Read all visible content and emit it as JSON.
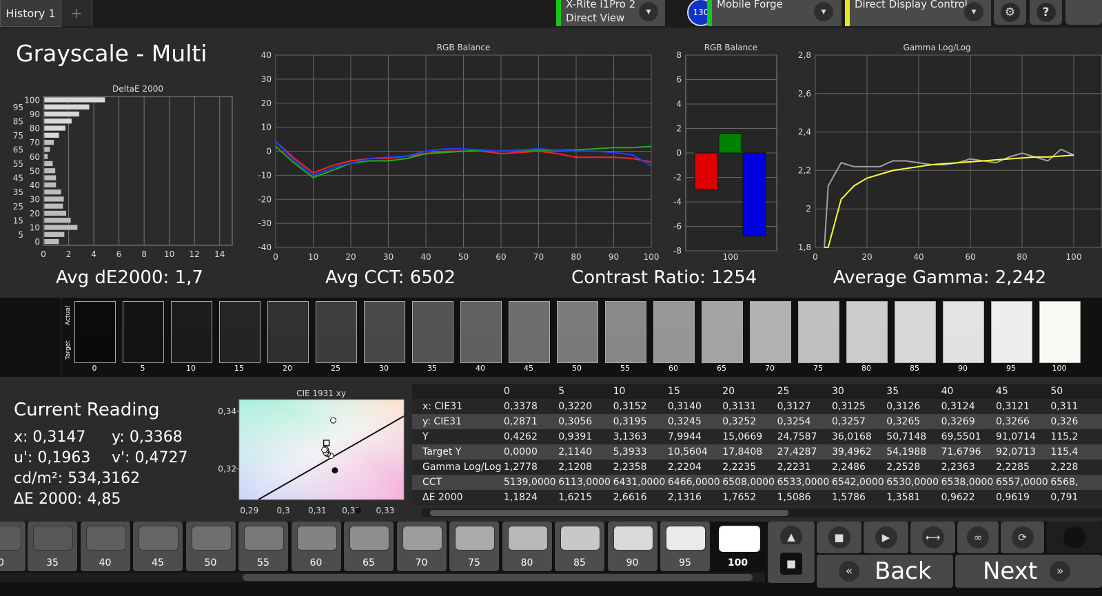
{
  "tabs": {
    "active": "History 1",
    "add": "+"
  },
  "devices": {
    "meter": {
      "line1": "X-Rite i1Pro 2",
      "line2": "Direct View",
      "color": "#18c818"
    },
    "badge": "130",
    "pattern_gen": {
      "label": "Mobile Forge",
      "color": "#18c818"
    },
    "display": {
      "label": "Direct Display Control",
      "color": "#e8e820"
    }
  },
  "icons": {
    "dropdown": "▾",
    "settings": "⚙",
    "help": "?"
  },
  "title": "Grayscale - Multi",
  "summary": {
    "avg_de": "Avg dE2000: 1,7",
    "avg_cct": "Avg CCT: 6502",
    "contrast": "Contrast Ratio: 1254",
    "gamma": "Average Gamma: 2,242"
  },
  "chart_data": [
    {
      "type": "bar",
      "title": "DeltaE 2000",
      "orientation": "horizontal",
      "categories": [
        "100",
        "95",
        "90",
        "85",
        "80",
        "75",
        "70",
        "65",
        "60",
        "55",
        "50",
        "45",
        "40",
        "35",
        "30",
        "25",
        "20",
        "15",
        "10",
        "5",
        "0"
      ],
      "values": [
        4.85,
        3.6,
        2.8,
        2.2,
        1.7,
        1.2,
        0.79,
        0.48,
        0.3,
        0.7,
        0.9,
        0.96,
        0.96,
        1.36,
        1.58,
        1.51,
        1.77,
        2.13,
        2.66,
        1.62,
        1.18
      ],
      "xticks": [
        "0",
        "2",
        "4",
        "6",
        "8",
        "10",
        "12",
        "14"
      ],
      "yticks": [
        "100",
        "95",
        "90",
        "85",
        "80",
        "75",
        "70",
        "65",
        "60",
        "55",
        "50",
        "45",
        "40",
        "35",
        "30",
        "25",
        "20",
        "15",
        "10",
        "5",
        "0"
      ],
      "xlim": [
        0,
        15
      ]
    },
    {
      "type": "line",
      "title": "RGB Balance",
      "x": [
        0,
        5,
        10,
        15,
        20,
        25,
        30,
        35,
        40,
        45,
        50,
        55,
        60,
        65,
        70,
        75,
        80,
        85,
        90,
        95,
        100
      ],
      "series": [
        {
          "color": "#ff2020",
          "values": [
            4,
            -3,
            -9,
            -6,
            -4,
            -3,
            -3,
            -2,
            -1,
            0,
            0,
            0,
            -1,
            -0.5,
            0,
            -1,
            -2.5,
            -2.5,
            -2.5,
            -3,
            -4.5
          ]
        },
        {
          "color": "#20b020",
          "values": [
            2,
            -5,
            -11,
            -8,
            -5,
            -4,
            -4,
            -3,
            -1,
            -0.5,
            0,
            0.5,
            0,
            0.5,
            0.5,
            0.5,
            0.5,
            1,
            1.5,
            1.5,
            2
          ]
        },
        {
          "color": "#2040ff",
          "values": [
            4,
            -4,
            -10,
            -7,
            -5,
            -3,
            -2.5,
            -2,
            0,
            1,
            1,
            0.5,
            0,
            0.5,
            1,
            0.5,
            0,
            0,
            -0.5,
            -1.5,
            -6
          ]
        }
      ],
      "xticks": [
        "0",
        "10",
        "20",
        "30",
        "40",
        "50",
        "60",
        "70",
        "80",
        "90",
        "100"
      ],
      "yticks": [
        "40",
        "30",
        "20",
        "10",
        "0",
        "-10",
        "-20",
        "-30",
        "-40"
      ],
      "ylim": [
        -40,
        40
      ]
    },
    {
      "type": "bar",
      "title": "RGB Balance",
      "categories": [
        "R",
        "G",
        "B"
      ],
      "series": [
        {
          "color": "#e00000",
          "values": [
            -3
          ]
        },
        {
          "color": "#008000",
          "values": [
            1.6
          ]
        },
        {
          "color": "#0000e0",
          "values": [
            -6.8
          ]
        }
      ],
      "xlabel_tick": "100",
      "yticks": [
        "8",
        "6",
        "4",
        "2",
        "0",
        "-2",
        "-4",
        "-6",
        "-8"
      ],
      "ylim": [
        -8,
        8
      ]
    },
    {
      "type": "line",
      "title": "Gamma Log/Log",
      "x": [
        0,
        5,
        10,
        15,
        20,
        25,
        30,
        35,
        40,
        45,
        50,
        55,
        60,
        65,
        70,
        75,
        80,
        85,
        90,
        95,
        100
      ],
      "series": [
        {
          "color": "#a0a0a0",
          "values": [
            1.28,
            2.12,
            2.24,
            2.22,
            2.22,
            2.22,
            2.25,
            2.25,
            2.24,
            2.23,
            2.23,
            2.24,
            2.26,
            2.25,
            2.24,
            2.27,
            2.29,
            2.27,
            2.25,
            2.31,
            2.28
          ]
        },
        {
          "color": "#ffff30",
          "values": [
            1.8,
            1.8,
            2.05,
            2.12,
            2.16,
            2.18,
            2.2,
            2.21,
            2.22,
            2.23,
            2.235,
            2.24,
            2.245,
            2.25,
            2.255,
            2.26,
            2.265,
            2.27,
            2.27,
            2.275,
            2.28
          ]
        }
      ],
      "xticks": [
        "0",
        "20",
        "40",
        "60",
        "80",
        "100"
      ],
      "yticks": [
        "2,8",
        "2,6",
        "2,4",
        "2,2",
        "2",
        "1,8"
      ],
      "ylim": [
        1.8,
        2.8
      ]
    },
    {
      "type": "scatter",
      "title": "CIE 1931 xy",
      "xticks": [
        "0,29",
        "0,3",
        "0,31",
        "0,32",
        "0,33"
      ],
      "yticks": [
        "0,34",
        "0,32"
      ],
      "target": {
        "x": 0.3127,
        "y": 0.329
      },
      "points": [
        {
          "x": 0.3147,
          "y": 0.3368
        },
        {
          "x": 0.314,
          "y": 0.3245
        },
        {
          "x": 0.3131,
          "y": 0.3252
        },
        {
          "x": 0.3127,
          "y": 0.3254
        },
        {
          "x": 0.3125,
          "y": 0.3257
        },
        {
          "x": 0.3126,
          "y": 0.3265
        },
        {
          "x": 0.3124,
          "y": 0.3269
        },
        {
          "x": 0.3121,
          "y": 0.3266
        },
        {
          "x": 0.3152,
          "y": 0.3195
        },
        {
          "x": 0.322,
          "y": 0.3056
        }
      ]
    }
  ],
  "swatches": {
    "actual_label": "Actual",
    "target_label": "Target",
    "labels": [
      "0",
      "5",
      "10",
      "15",
      "20",
      "25",
      "30",
      "35",
      "40",
      "45",
      "50",
      "55",
      "60",
      "65",
      "70",
      "75",
      "80",
      "85",
      "90",
      "95",
      "100"
    ],
    "actual_colors": [
      "#0c0c0c",
      "#141214",
      "#1d1b1d",
      "#262426",
      "#333133",
      "#3f3d3f",
      "#4a484a",
      "#555355",
      "#626062",
      "#6f6d6f",
      "#7c7a7c",
      "#8a888a",
      "#989698",
      "#a5a3a5",
      "#b3b1b3",
      "#c1bfc1",
      "#cdcbcd",
      "#d9d7d9",
      "#e4e2e4",
      "#eeeeee",
      "#fafaf5"
    ],
    "target_colors": [
      "#0a0a0a",
      "#131113",
      "#1b1a1b",
      "#252325",
      "#322f32",
      "#3d3b3d",
      "#494749",
      "#545254",
      "#615f61",
      "#6e6c6e",
      "#7b797b",
      "#898789",
      "#979597",
      "#a4a2a4",
      "#b2b0b2",
      "#c0bec0",
      "#cccacc",
      "#d8d6d8",
      "#e3e1e3",
      "#ededed",
      "#fafaf5"
    ]
  },
  "current_reading": {
    "title": "Current Reading",
    "x": "x: 0,3147",
    "y": "y: 0,3368",
    "u": "u': 0,1963",
    "v": "v': 0,4727",
    "cd": "cd/m²: 534,3162",
    "de": "ΔE 2000: 4,85"
  },
  "table": {
    "columns": [
      "0",
      "5",
      "10",
      "15",
      "20",
      "25",
      "30",
      "35",
      "40",
      "45",
      "50"
    ],
    "rows": [
      {
        "label": "x: CIE31",
        "values": [
          "0,3378",
          "0,3220",
          "0,3152",
          "0,3140",
          "0,3131",
          "0,3127",
          "0,3125",
          "0,3126",
          "0,3124",
          "0,3121",
          "0,311"
        ]
      },
      {
        "label": "y: CIE31",
        "values": [
          "0,2871",
          "0,3056",
          "0,3195",
          "0,3245",
          "0,3252",
          "0,3254",
          "0,3257",
          "0,3265",
          "0,3269",
          "0,3266",
          "0,326"
        ]
      },
      {
        "label": "Y",
        "values": [
          "0,4262",
          "0,9391",
          "3,1363",
          "7,9944",
          "15,0669",
          "24,7587",
          "36,0168",
          "50,7148",
          "69,5501",
          "91,0714",
          "115,2"
        ]
      },
      {
        "label": "Target Y",
        "values": [
          "0,0000",
          "2,1140",
          "5,3933",
          "10,5604",
          "17,8408",
          "27,4287",
          "39,4962",
          "54,1988",
          "71,6796",
          "92,0713",
          "115,4"
        ]
      },
      {
        "label": "Gamma Log/Log",
        "values": [
          "1,2778",
          "2,1208",
          "2,2358",
          "2,2204",
          "2,2235",
          "2,2231",
          "2,2486",
          "2,2528",
          "2,2363",
          "2,2285",
          "2,228"
        ]
      },
      {
        "label": "CCT",
        "values": [
          "5139,0000",
          "6113,0000",
          "6431,0000",
          "6466,0000",
          "6508,0000",
          "6533,0000",
          "6542,0000",
          "6530,0000",
          "6538,0000",
          "6557,0000",
          "6568,"
        ]
      },
      {
        "label": "ΔE 2000",
        "values": [
          "1,1824",
          "1,6215",
          "2,6616",
          "2,1316",
          "1,7652",
          "1,5086",
          "1,5786",
          "1,3581",
          "0,9622",
          "0,9619",
          "0,791"
        ]
      }
    ]
  },
  "footer": {
    "swatch_labels": [
      "0",
      "35",
      "40",
      "45",
      "50",
      "55",
      "60",
      "65",
      "70",
      "75",
      "80",
      "85",
      "90",
      "95",
      "100"
    ],
    "swatch_colors": [
      "#5a5a5a",
      "#575757",
      "#5f5f5f",
      "#666666",
      "#6f6f6f",
      "#787878",
      "#838383",
      "#8f8f8f",
      "#9d9d9d",
      "#aaaaaa",
      "#b9b9b9",
      "#c8c8c8",
      "#d9d9d9",
      "#eaeaea",
      "#ffffff"
    ],
    "selected": "100",
    "back": "Back",
    "next": "Next",
    "controls": {
      "up": "▲",
      "stop": "■",
      "play": "▶",
      "fit": "⟷",
      "loop": "∞",
      "refresh": "⟳",
      "back_icon": "«",
      "next_icon": "»"
    }
  }
}
